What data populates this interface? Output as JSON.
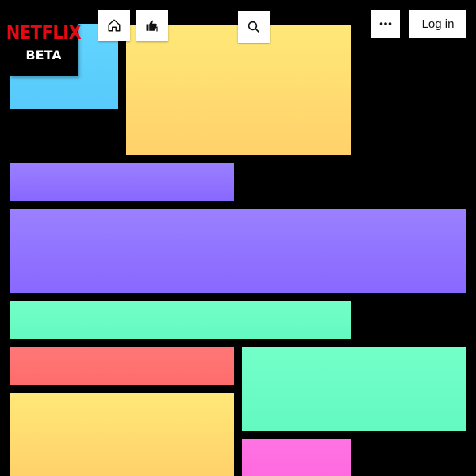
{
  "logo": {
    "word": "NETFLIX",
    "sub": "BETA"
  },
  "header": {
    "login_label": "Log in",
    "icons": [
      "home-icon",
      "thumbs-up-icon",
      "search-icon",
      "more-icon"
    ]
  },
  "colors": {
    "background": "#000000",
    "brand_red": "#e50914",
    "tile_blue": "#5ccffd",
    "tile_yellow": "#ffdc70",
    "tile_purple": "#9174ff",
    "tile_mint": "#6bfcc4",
    "tile_red": "#ff7171",
    "tile_pink": "#ff6fe1"
  }
}
